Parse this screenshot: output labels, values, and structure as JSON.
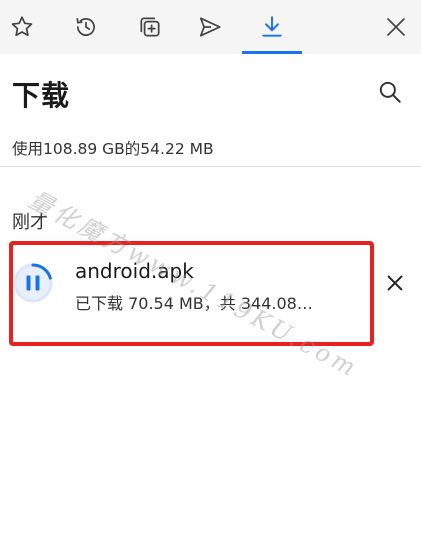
{
  "toolbar": {
    "icons": [
      "star-icon",
      "history-icon",
      "collections-icon",
      "share-icon",
      "download-icon",
      "close-icon"
    ],
    "accent": "#1a73e8"
  },
  "header": {
    "title": "下载"
  },
  "storage": {
    "text": "使用108.89 GB的54.22 MB"
  },
  "section": {
    "label": "刚才"
  },
  "download": {
    "filename": "android.apk",
    "status": "已下载 70.54 MB，共 344.08…",
    "progress": 0.205,
    "highlight_color": "#e8201f"
  },
  "watermark": {
    "text": "量化魔方www.119KU.com"
  }
}
